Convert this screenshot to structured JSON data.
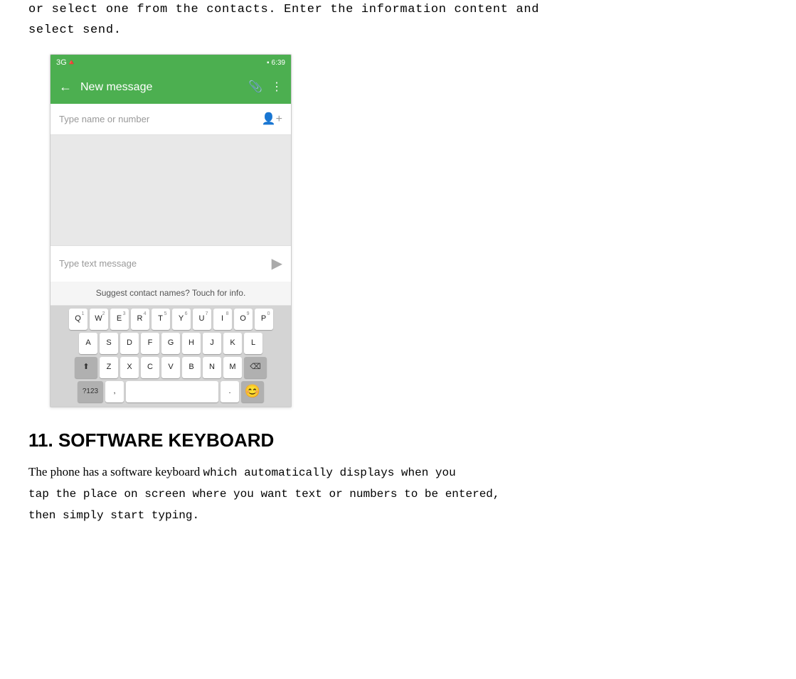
{
  "intro": {
    "line1": "or select one from the contacts.  Enter the information content and",
    "line2": "select send."
  },
  "phone": {
    "status_bar": {
      "network": "3G",
      "signal": "▲",
      "battery": "■",
      "time": "6:39"
    },
    "header": {
      "back_label": "←",
      "title": "New message",
      "attachment_icon": "📎",
      "more_icon": "⋮"
    },
    "to_field": {
      "placeholder": "Type name or number",
      "add_contact_icon": "👤+"
    },
    "text_input": {
      "placeholder": "Type text message",
      "send_icon": "▶"
    },
    "suggestion_bar": {
      "text": "Suggest contact names? Touch for info."
    },
    "keyboard": {
      "row1": [
        {
          "label": "Q",
          "num": "1"
        },
        {
          "label": "W",
          "num": "2"
        },
        {
          "label": "E",
          "num": "3"
        },
        {
          "label": "R",
          "num": "4"
        },
        {
          "label": "T",
          "num": "5"
        },
        {
          "label": "Y",
          "num": "6"
        },
        {
          "label": "U",
          "num": "7"
        },
        {
          "label": "I",
          "num": "8"
        },
        {
          "label": "O",
          "num": "9"
        },
        {
          "label": "P",
          "num": "0"
        }
      ],
      "row2": [
        {
          "label": "A"
        },
        {
          "label": "S"
        },
        {
          "label": "D"
        },
        {
          "label": "F"
        },
        {
          "label": "G"
        },
        {
          "label": "H"
        },
        {
          "label": "J"
        },
        {
          "label": "K"
        },
        {
          "label": "L"
        }
      ],
      "row3": [
        {
          "label": "⬆",
          "special": true
        },
        {
          "label": "Z"
        },
        {
          "label": "X"
        },
        {
          "label": "C"
        },
        {
          "label": "V"
        },
        {
          "label": "B"
        },
        {
          "label": "N"
        },
        {
          "label": "M"
        },
        {
          "label": "⌫",
          "special": true
        }
      ],
      "row4": [
        {
          "label": "?123",
          "special": true
        },
        {
          "label": ","
        },
        {
          "label": " ",
          "space": true
        },
        {
          "label": "."
        },
        {
          "label": "😊",
          "special": true
        }
      ]
    }
  },
  "section": {
    "number": "11.",
    "title": "SOFTWARE KEYBOARD"
  },
  "body_text": {
    "part1_normal": "The phone has a software keyboard ",
    "part1_mono": "which automatically displays when you",
    "part2_mono": "tap the place on screen where you want text or numbers to be entered,",
    "part3_mono": "then simply start typing."
  }
}
